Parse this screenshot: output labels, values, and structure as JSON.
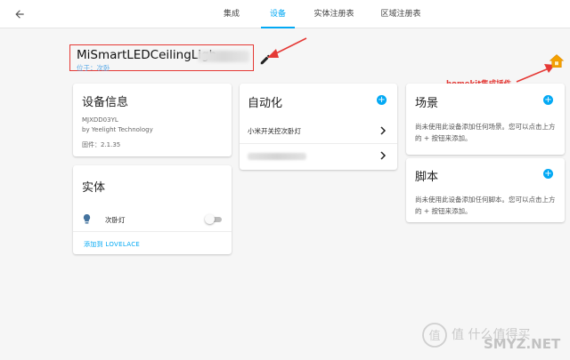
{
  "header": {
    "tabs": [
      {
        "label": "集成"
      },
      {
        "label": "设备"
      },
      {
        "label": "实体注册表"
      },
      {
        "label": "区域注册表"
      }
    ],
    "active_tab": "设备"
  },
  "device": {
    "name": "MiSmartLEDCeilingLigh",
    "area_label": "位于：次卧"
  },
  "annotation": {
    "text": "homekit集成插件"
  },
  "device_info_card": {
    "title": "设备信息",
    "model": "MJXDD03YL",
    "manufacturer": "by Yeelight Technology",
    "firmware": "固件：2.1.35"
  },
  "entities_card": {
    "title": "实体",
    "items": [
      {
        "name": "次卧灯",
        "icon": "lightbulb-icon",
        "state": "off"
      }
    ],
    "add_to_lovelace": "添加到 LOVELACE"
  },
  "automation_card": {
    "title": "自动化",
    "add_icon": "plus",
    "items": [
      {
        "label": "小米开关控次卧灯"
      }
    ]
  },
  "scene_card": {
    "title": "场景",
    "description": "尚未使用此设备添加任何场景。您可以点击上方的 + 按钮来添加。"
  },
  "script_card": {
    "title": "脚本",
    "description": "尚未使用此设备添加任何脚本。您可以点击上方的 + 按钮来添加。"
  },
  "watermark": {
    "slogan": "值 什么值得买",
    "brand": "SMYZ.NET"
  },
  "colors": {
    "accent": "#03a9f4",
    "annotation_red": "#e53935",
    "homekit_orange": "#f4a100"
  }
}
